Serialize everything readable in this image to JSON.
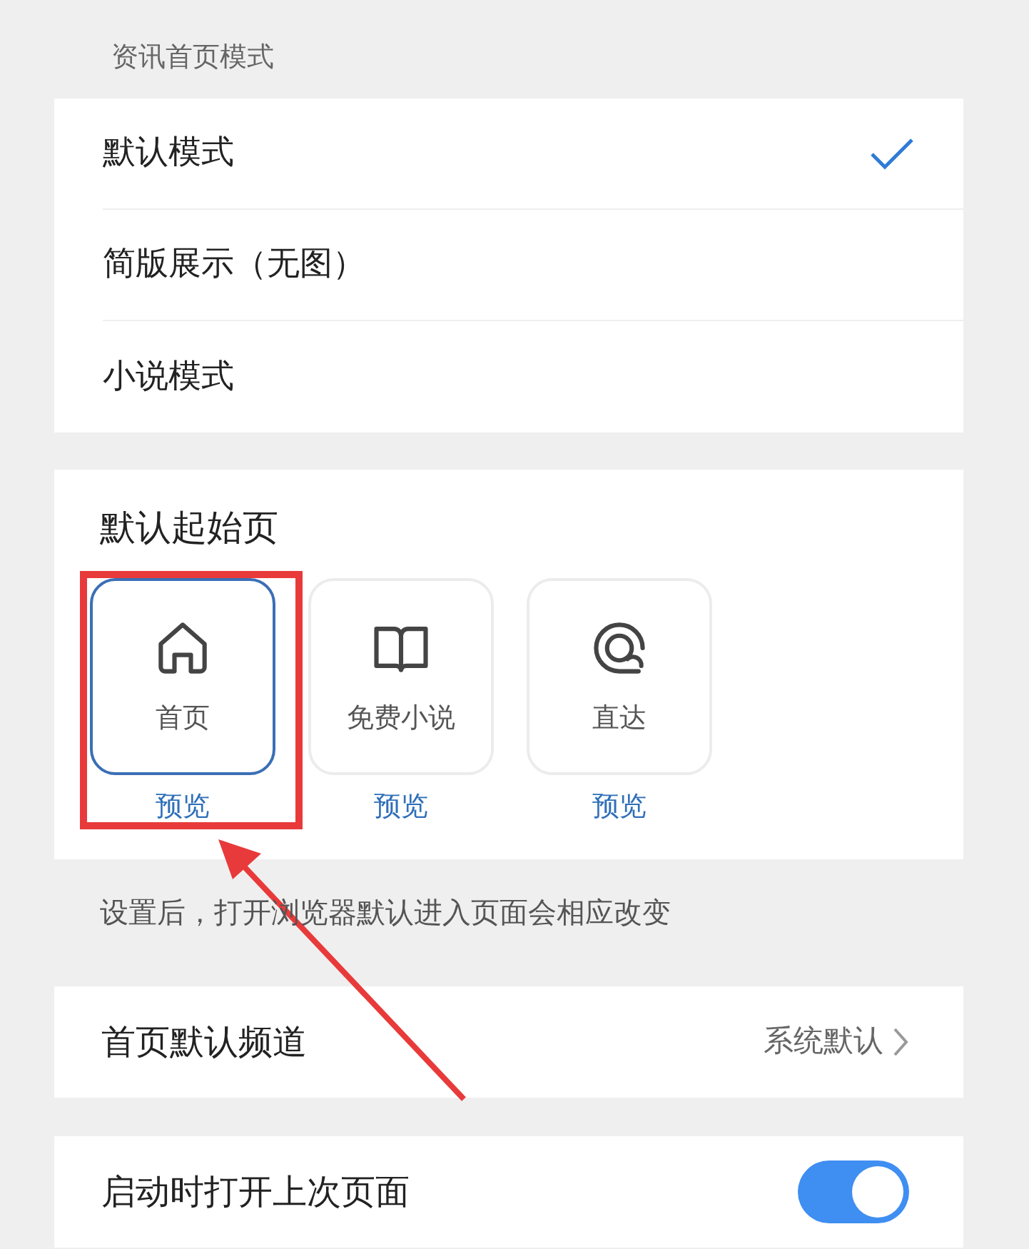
{
  "section_title": "资讯首页模式",
  "modes": [
    {
      "label": "默认模式",
      "selected": true
    },
    {
      "label": "简版展示（无图）",
      "selected": false
    },
    {
      "label": "小说模式",
      "selected": false
    }
  ],
  "start_page": {
    "title": "默认起始页",
    "cards": [
      {
        "kind": "home",
        "label": "首页",
        "preview": "预览",
        "selected": true,
        "highlighted": true
      },
      {
        "kind": "book",
        "label": "免费小说",
        "preview": "预览",
        "selected": false,
        "highlighted": false
      },
      {
        "kind": "direct",
        "label": "直达",
        "preview": "预览",
        "selected": false,
        "highlighted": false
      }
    ]
  },
  "note": "设置后，打开浏览器默认进入页面会相应改变",
  "channel_row": {
    "label": "首页默认频道",
    "value": "系统默认"
  },
  "restore_row": {
    "label": "启动时打开上次页面",
    "on": true
  }
}
